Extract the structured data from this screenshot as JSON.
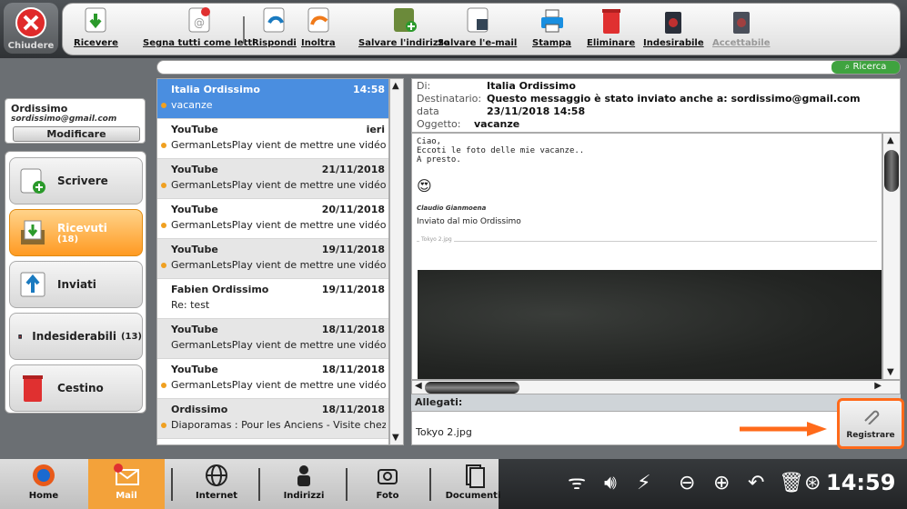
{
  "toolbar": {
    "close": "Chiudere",
    "buttons": [
      "Ricevere",
      "Segna tutti come letti",
      "Rispondi",
      "Inoltra",
      "Salvare l'indirizzo",
      "Salvare l'e-mail",
      "Stampa",
      "Eliminare",
      "Indesirabile",
      "Accettabile"
    ],
    "search": "Ricerca"
  },
  "account": {
    "name": "Ordissimo",
    "email": "sordissimo@gmail.com",
    "modify": "Modificare"
  },
  "folders": [
    {
      "label": "Scrivere",
      "count": ""
    },
    {
      "label": "Ricevuti",
      "count": "(18)"
    },
    {
      "label": "Inviati",
      "count": ""
    },
    {
      "label": "Indesiderabili",
      "count": "(13)"
    },
    {
      "label": "Cestino",
      "count": ""
    }
  ],
  "emails": [
    {
      "sender": "Italia Ordissimo",
      "date": "14:58",
      "preview": "vacanze"
    },
    {
      "sender": "YouTube",
      "date": "ieri",
      "preview": "GermanLetsPlay vient de mettre une vidéo en l..."
    },
    {
      "sender": "YouTube",
      "date": "21/11/2018",
      "preview": "GermanLetsPlay vient de mettre une vidéo en l..."
    },
    {
      "sender": "YouTube",
      "date": "20/11/2018",
      "preview": "GermanLetsPlay vient de mettre une vidéo en l..."
    },
    {
      "sender": "YouTube",
      "date": "19/11/2018",
      "preview": "GermanLetsPlay vient de mettre une vidéo en l..."
    },
    {
      "sender": "Fabien Ordissimo",
      "date": "19/11/2018",
      "preview": "Re: test"
    },
    {
      "sender": "YouTube",
      "date": "18/11/2018",
      "preview": "GermanLetsPlay vient de mettre une vidéo en li..."
    },
    {
      "sender": "YouTube",
      "date": "18/11/2018",
      "preview": "GermanLetsPlay vient de mettre une vidéo en l..."
    },
    {
      "sender": "Ordissimo",
      "date": "18/11/2018",
      "preview": "Diaporamas : Pour les Anciens - Visite chez le..."
    }
  ],
  "message": {
    "from_label": "Di:",
    "from": "Italia Ordissimo",
    "to_label": "Destinatario:",
    "to": "Questo messaggio è stato inviato anche a: sordissimo@gmail.com",
    "date_label": "data",
    "date": "23/11/2018 14:58",
    "subject_label": "Oggetto:",
    "subject": "vacanze",
    "lines": [
      "Ciao,",
      "Eccoti le foto delle mie vacanze..",
      "A presto."
    ],
    "signature_name": "Claudio Gianmoena",
    "signature_line": "Inviato dal mio Ordissimo",
    "inline_label": "Tokyo 2.jpg"
  },
  "attachments": {
    "header": "Allegati:",
    "file": "Tokyo 2.jpg",
    "save": "Registrare"
  },
  "taskbar": {
    "items": [
      "Home",
      "Mail",
      "Internet",
      "Indirizzi",
      "Foto",
      "Documenti"
    ],
    "clock": "14:59"
  }
}
